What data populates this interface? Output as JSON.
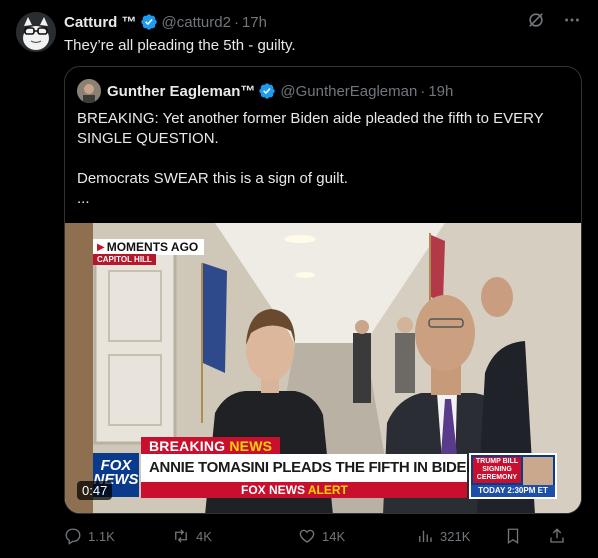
{
  "tweet": {
    "author_name": "Catturd ™",
    "handle": "@catturd2",
    "time": "17h",
    "text": "They’re all pleading the 5th - guilty."
  },
  "quote": {
    "author_name": "Gunther Eagleman™",
    "handle": "@GuntherEagleman",
    "time": "19h",
    "line1": "BREAKING: Yet another former Biden aide pleaded the fifth to EVERY SINGLE QUESTION.",
    "line2": "Democrats SWEAR this is a sign of guilt.",
    "line3": "...",
    "video": {
      "moments_ago": "MOMENTS AGO",
      "location": "CAPITOL HILL",
      "breaking_label_1": "BREAKING ",
      "breaking_label_2": "NEWS",
      "network_logo": "FOX NEWS",
      "headline": "ANNIE TOMASINI PLEADS THE FIFTH IN BIDEN PROBE",
      "alert_1": "FOX NEWS ",
      "alert_2": "ALERT",
      "promo_title": "TRUMP BILL SIGNING CEREMONY",
      "promo_time": "TODAY 2:30PM ET",
      "duration": "0:47"
    }
  },
  "actions": {
    "replies": "1.1K",
    "reposts": "4K",
    "likes": "14K",
    "views": "321K"
  },
  "colors": {
    "verified": "#1d9bf0",
    "muted": "#71767b",
    "background": "#000000",
    "border": "#2f3336"
  }
}
